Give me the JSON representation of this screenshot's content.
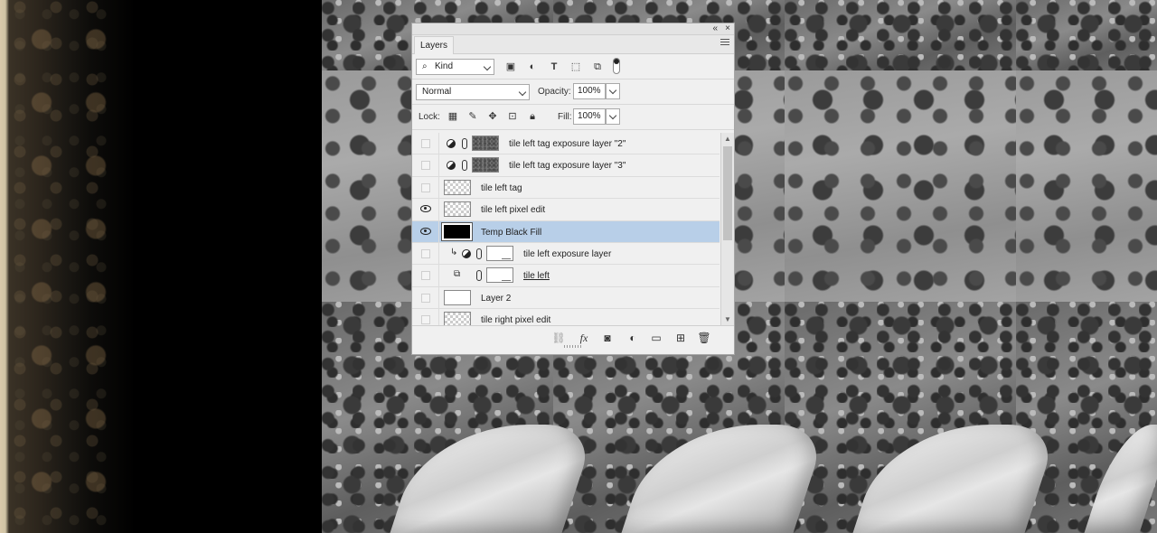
{
  "panel": {
    "tab_label": "Layers",
    "collapse_icon": "collapse-icon",
    "close_icon": "close-icon",
    "menu_icon": "panel-menu-icon"
  },
  "filter": {
    "kind_label": "Kind",
    "icons": [
      "search-icon",
      "pixel-filter-icon",
      "adjustment-filter-icon",
      "type-filter-icon",
      "shape-filter-icon",
      "smart-object-filter-icon"
    ]
  },
  "blend": {
    "mode": "Normal",
    "opacity_label": "Opacity:",
    "opacity_value": "100%"
  },
  "lock": {
    "label": "Lock:",
    "fill_label": "Fill:",
    "fill_value": "100%",
    "icons": [
      "lock-transparent-icon",
      "lock-image-icon",
      "lock-position-icon",
      "lock-artboard-icon",
      "lock-all-icon"
    ]
  },
  "layers": [
    {
      "name": "tile left tag exposure layer \"2\"",
      "visible": false,
      "thumb": "noise",
      "adjustment": true,
      "selected": false
    },
    {
      "name": "tile left tag exposure layer \"3\"",
      "visible": false,
      "thumb": "noise",
      "adjustment": true,
      "selected": false
    },
    {
      "name": "tile left tag",
      "visible": false,
      "thumb": "checker",
      "selected": false
    },
    {
      "name": "tile left pixel edit",
      "visible": true,
      "thumb": "checker",
      "selected": false
    },
    {
      "name": "Temp Black Fill",
      "visible": true,
      "thumb": "black",
      "selected": true
    },
    {
      "name": "tile left exposure layer",
      "visible": false,
      "thumb": "mask",
      "clipped": true,
      "selected": false
    },
    {
      "name": "tile left",
      "visible": false,
      "thumb": "mask",
      "smart": true,
      "selected": false
    },
    {
      "name": "Layer 2",
      "visible": false,
      "thumb": "white",
      "selected": false
    },
    {
      "name": "tile right pixel edit",
      "visible": false,
      "thumb": "checker",
      "selected": false
    }
  ],
  "bottom_icons": [
    "link-layers-icon",
    "fx-icon",
    "add-mask-icon",
    "new-adjustment-icon",
    "new-group-icon",
    "new-layer-icon",
    "delete-layer-icon"
  ],
  "bottom_fx": "fx"
}
